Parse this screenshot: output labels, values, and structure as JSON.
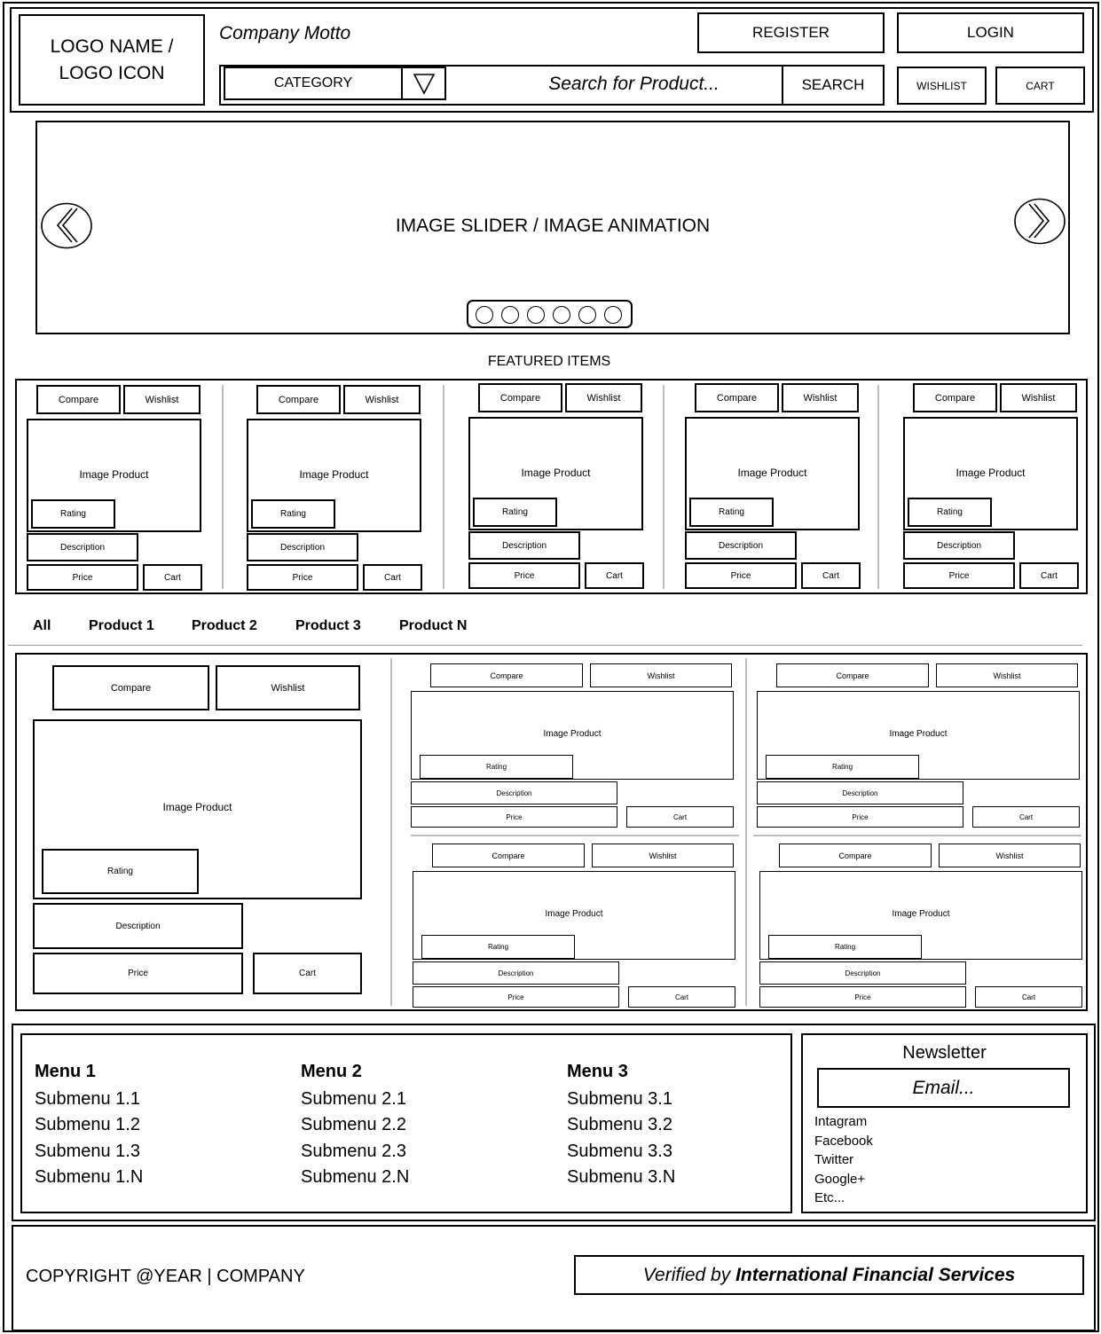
{
  "header": {
    "logo": "LOGO NAME / LOGO ICON",
    "motto": "Company Motto",
    "register_label": "REGISTER",
    "login_label": "LOGIN",
    "category_label": "CATEGORY",
    "search_placeholder": "Search for Product...",
    "search_label": "SEARCH",
    "wishlist_label": "WISHLIST",
    "cart_label": "CART"
  },
  "slider": {
    "caption": "IMAGE SLIDER / IMAGE ANIMATION",
    "dot_count": 6
  },
  "featured": {
    "title": "FEATURED ITEMS",
    "card": {
      "compare": "Compare",
      "wishlist": "Wishlist",
      "image": "Image Product",
      "rating": "Rating",
      "description": "Description",
      "price": "Price",
      "cart": "Cart"
    }
  },
  "tabs": [
    "All",
    "Product 1",
    "Product 2",
    "Product 3",
    "Product N"
  ],
  "footer": {
    "menus": [
      {
        "title": "Menu 1",
        "items": [
          "Submenu 1.1",
          "Submenu 1.2",
          "Submenu 1.3",
          "Submenu 1.N"
        ]
      },
      {
        "title": "Menu 2",
        "items": [
          "Submenu 2.1",
          "Submenu 2.2",
          "Submenu 2.3",
          "Submenu 2.N"
        ]
      },
      {
        "title": "Menu 3",
        "items": [
          "Submenu 3.1",
          "Submenu 3.2",
          "Submenu 3.3",
          "Submenu 3.N"
        ]
      }
    ],
    "newsletter_title": "Newsletter",
    "email_placeholder": "Email...",
    "social": [
      "Intagram",
      "Facebook",
      "Twitter",
      "Google+",
      "Etc..."
    ],
    "copyright": "COPYRIGHT @YEAR | COMPANY",
    "verified_prefix": "Verified by",
    "verified_company": "International Financial Services"
  }
}
